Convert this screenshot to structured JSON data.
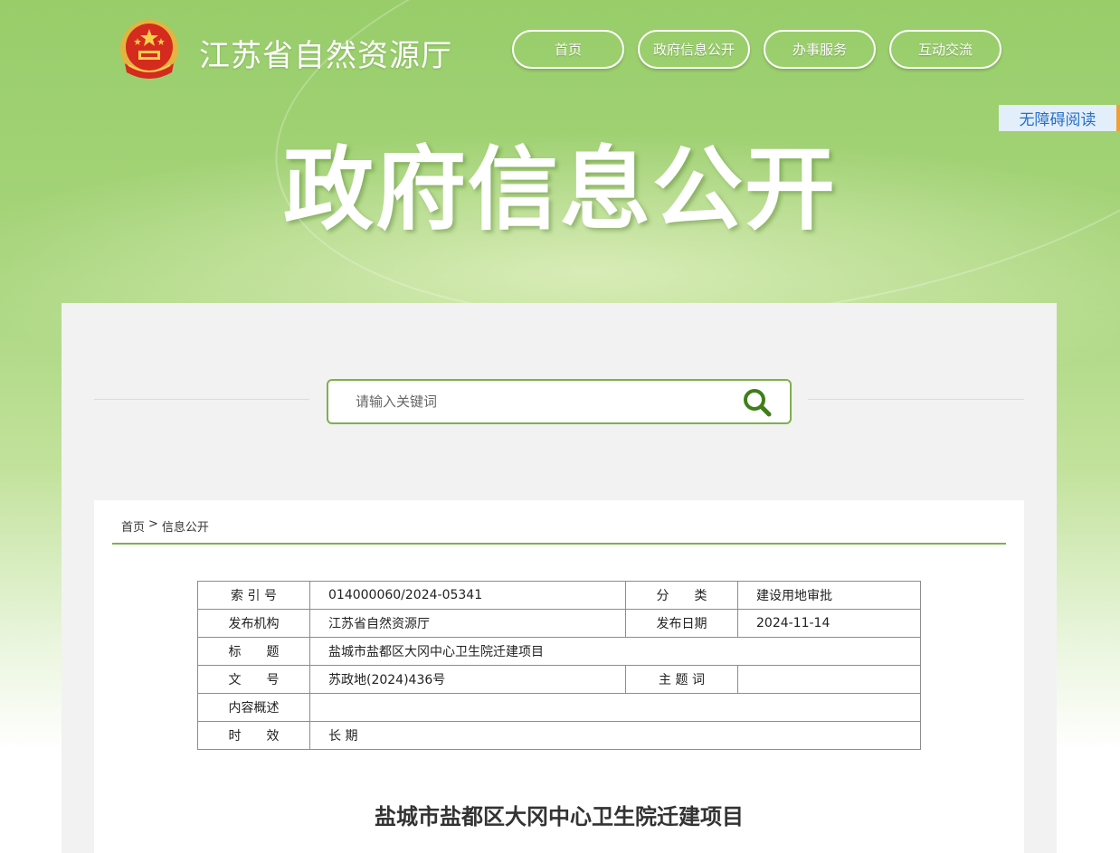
{
  "header": {
    "site_title": "江苏省自然资源厅",
    "hero_title": "政府信息公开",
    "accessibility_label": "无障碍阅读",
    "nav": [
      {
        "label": "首页"
      },
      {
        "label": "政府信息公开"
      },
      {
        "label": "办事服务"
      },
      {
        "label": "互动交流"
      }
    ]
  },
  "search": {
    "placeholder": "请输入关键词"
  },
  "breadcrumb": {
    "home": "首页",
    "separator": ">",
    "current": "信息公开"
  },
  "meta": {
    "index_no_label": "索 引 号",
    "index_no": "014000060/2024-05341",
    "category_label": "分　　类",
    "category": "建设用地审批",
    "publisher_label": "发布机构",
    "publisher": "江苏省自然资源厅",
    "date_label": "发布日期",
    "date": "2024-11-14",
    "title_label": "标　　题",
    "title": "盐城市盐都区大冈中心卫生院迁建项目",
    "doc_no_label": "文　　号",
    "doc_no": "苏政地(2024)436号",
    "keywords_label": "主 题 词",
    "keywords": "",
    "summary_label": "内容概述",
    "summary": "",
    "validity_label": "时　　效",
    "validity": "长 期"
  },
  "document": {
    "heading": "盐城市盐都区大冈中心卫生院迁建项目"
  },
  "colors": {
    "accent_green": "#7fb04c",
    "banner_green": "#98cd6a"
  }
}
